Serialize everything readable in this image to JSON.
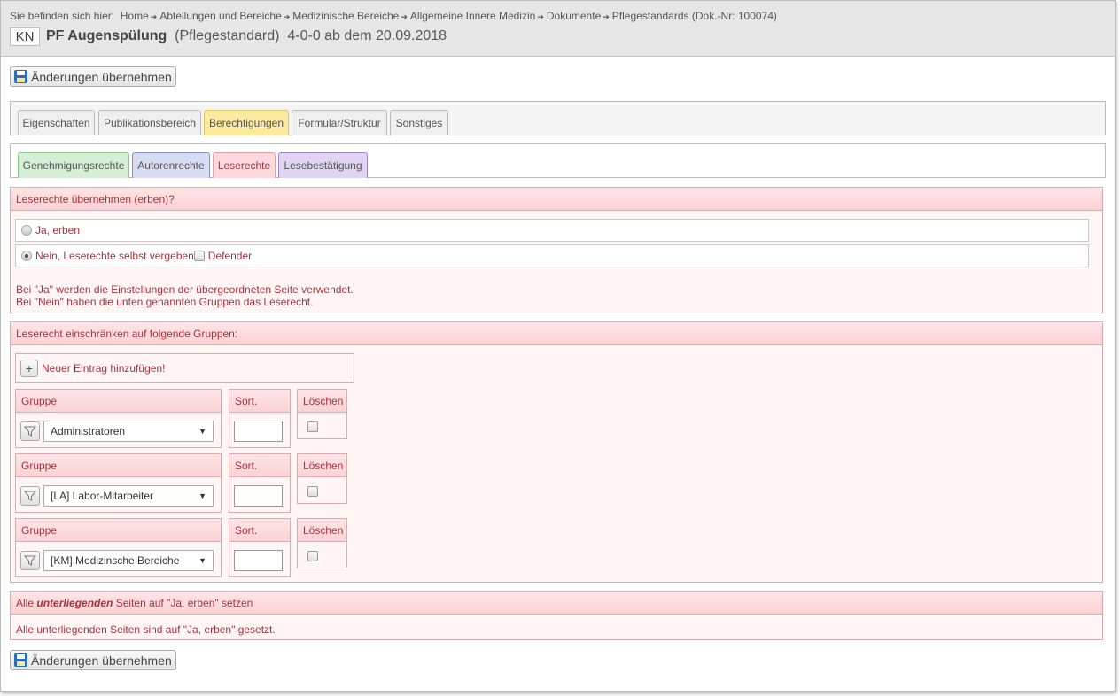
{
  "breadcrumb": {
    "prefix": "Sie befinden sich hier:",
    "items": [
      "Home",
      "Abteilungen und Bereiche",
      "Medizinische Bereiche",
      "Allgemeine Innere Medizin",
      "Dokumente",
      "Pflegestandards (Dok.-Nr: 100074)"
    ]
  },
  "header": {
    "badge": "KN",
    "title": "PF Augenspülung",
    "type": "(Pflegestandard)",
    "version": "4-0-0 ab dem 20.09.2018"
  },
  "save_label": "Änderungen übernehmen",
  "tabs": [
    "Eigenschaften",
    "Publikationsbereich",
    "Berechtigungen",
    "Formular/Struktur",
    "Sonstiges"
  ],
  "subtabs": [
    "Genehmigungsrechte",
    "Autorenrechte",
    "Leserechte",
    "Lesebestätigung"
  ],
  "inherit": {
    "title": "Leserechte übernehmen (erben)?",
    "option_yes": "Ja, erben",
    "option_no": "Nein, Leserechte selbst vergeben",
    "defender": "Defender",
    "selected": "no",
    "hint1": "Bei \"Ja\" werden die Einstellungen der übergeordneten Seite verwendet.",
    "hint2": "Bei \"Nein\" haben die unten genannten Gruppen das Leserecht."
  },
  "groups": {
    "title": "Leserecht einschränken auf folgende Gruppen:",
    "add_label": "Neuer Eintrag hinzufügen!",
    "col_group": "Gruppe",
    "col_sort": "Sort.",
    "col_delete": "Löschen",
    "rows": [
      {
        "group": "Administratoren",
        "sort": ""
      },
      {
        "group": "[LA] Labor-Mitarbeiter",
        "sort": ""
      },
      {
        "group": "[KM] Medizinsche Bereiche",
        "sort": ""
      }
    ]
  },
  "subpages": {
    "title_pre": "Alle",
    "title_em": "unterliegenden",
    "title_post": "Seiten auf \"Ja, erben\" setzen",
    "status": "Alle unterliegenden Seiten sind auf \"Ja, erben\" gesetzt."
  },
  "colors": {
    "tab_active": "#fbeaa0",
    "green": "#d4efd6",
    "blue": "#d8dcf2",
    "pink": "#fdd8dc",
    "purple": "#e0d4f2"
  }
}
